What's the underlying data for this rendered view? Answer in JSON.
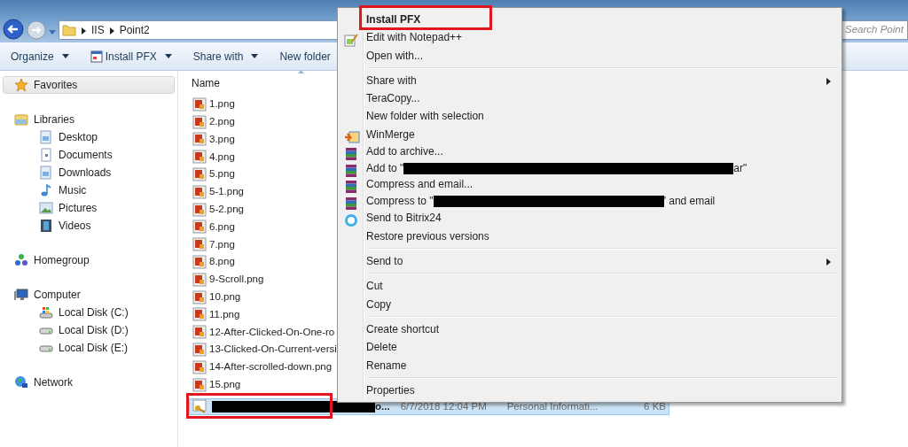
{
  "window": {
    "back": {
      "disabled": false
    },
    "forward": {
      "disabled": true
    },
    "breadcrumbs": [
      "IIS",
      "Point2"
    ],
    "search": {
      "placeholder": "Search Point"
    }
  },
  "toolbar": [
    {
      "label": "Organize",
      "dropdown": true,
      "kind": "plain"
    },
    {
      "label": "Install PFX",
      "dropdown": true,
      "kind": "app"
    },
    {
      "label": "Share with",
      "dropdown": true,
      "kind": "plain"
    },
    {
      "label": "New folder",
      "dropdown": false,
      "kind": "plain"
    }
  ],
  "navigation": [
    {
      "label": "Favorites",
      "kind": "favorites",
      "selected": true
    },
    {
      "label": "Libraries",
      "kind": "library",
      "selected": false,
      "children": [
        {
          "label": "Desktop",
          "kind": "desktop",
          "selected": false
        },
        {
          "label": "Documents",
          "kind": "documents",
          "selected": false
        },
        {
          "label": "Downloads",
          "kind": "desktop",
          "selected": false
        },
        {
          "label": "Music",
          "kind": "music",
          "selected": false
        },
        {
          "label": "Pictures",
          "kind": "pictures",
          "selected": false
        },
        {
          "label": "Videos",
          "kind": "videos",
          "selected": false
        }
      ]
    },
    {
      "label": "Homegroup",
      "kind": "homegroup",
      "selected": false
    },
    {
      "label": "Computer",
      "kind": "computer",
      "selected": false,
      "children": [
        {
          "label": "Local Disk (C:)",
          "kind": "system-disk",
          "selected": false
        },
        {
          "label": "Local Disk (D:)",
          "kind": "disk",
          "selected": false
        },
        {
          "label": "Local Disk (E:)",
          "kind": "disk",
          "selected": false
        }
      ]
    },
    {
      "label": "Network",
      "kind": "network",
      "selected": false
    }
  ],
  "file_list": {
    "columns": [
      {
        "label": "Name",
        "sorted": true
      }
    ],
    "rows": [
      {
        "kind": "image",
        "name": "1.png",
        "selected": false,
        "highlighted": false
      },
      {
        "kind": "image",
        "name": "2.png",
        "selected": false,
        "highlighted": false
      },
      {
        "kind": "image",
        "name": "3.png",
        "selected": false,
        "highlighted": false
      },
      {
        "kind": "image",
        "name": "4.png",
        "selected": false,
        "highlighted": false
      },
      {
        "kind": "image",
        "name": "5.png",
        "selected": false,
        "highlighted": false
      },
      {
        "kind": "image",
        "name": "5-1.png",
        "selected": false,
        "highlighted": false
      },
      {
        "kind": "image",
        "name": "5-2.png",
        "selected": false,
        "highlighted": false
      },
      {
        "kind": "image",
        "name": "6.png",
        "selected": false,
        "highlighted": false
      },
      {
        "kind": "image",
        "name": "7.png",
        "selected": false,
        "highlighted": false
      },
      {
        "kind": "image",
        "name": "8.png",
        "selected": false,
        "highlighted": false
      },
      {
        "kind": "image",
        "name": "9-Scroll.png",
        "selected": false,
        "highlighted": false
      },
      {
        "kind": "image",
        "name": "10.png",
        "selected": false,
        "highlighted": false
      },
      {
        "kind": "image",
        "name": "11.png",
        "selected": false,
        "highlighted": false
      },
      {
        "kind": "image",
        "name": "12-After-Clicked-On-One-ro",
        "selected": false,
        "highlighted": false
      },
      {
        "kind": "image",
        "name": "13-Clicked-On-Current-versi",
        "selected": false,
        "highlighted": false
      },
      {
        "kind": "image",
        "name": "14-After-scrolled-down.png",
        "selected": false,
        "highlighted": false
      },
      {
        "kind": "image",
        "name": "15.png",
        "selected": false,
        "highlighted": false
      },
      {
        "kind": "certificate-redacted",
        "name": "o...",
        "date": "6/7/2018 12:04 PM",
        "type": "Personal Informati...",
        "size": "6 KB",
        "selected": true,
        "highlighted": true
      }
    ]
  },
  "context_menu": [
    {
      "kind": "plain",
      "label": "Install PFX",
      "default": true,
      "submenu": false,
      "highlighted": true
    },
    {
      "kind": "notepad",
      "label": "Edit with Notepad++",
      "default": false,
      "submenu": false,
      "highlighted": false
    },
    {
      "kind": "plain",
      "label": "Open with...",
      "default": false,
      "submenu": false,
      "highlighted": false
    },
    {
      "kind": "separator"
    },
    {
      "kind": "plain",
      "label": "Share with",
      "default": false,
      "submenu": true,
      "highlighted": false
    },
    {
      "kind": "plain",
      "label": "TeraCopy...",
      "default": false,
      "submenu": false,
      "highlighted": false
    },
    {
      "kind": "plain",
      "label": "New folder with selection",
      "default": false,
      "submenu": false,
      "highlighted": false
    },
    {
      "kind": "merge",
      "label": "WinMerge",
      "default": false,
      "submenu": false,
      "highlighted": false
    },
    {
      "kind": "archive",
      "label": "Add to archive...",
      "default": false,
      "submenu": false,
      "highlighted": false
    },
    {
      "kind": "archive-redacted",
      "label": "Add to \"",
      "after": "ar\"",
      "default": false,
      "submenu": false,
      "highlighted": false
    },
    {
      "kind": "archive",
      "label": "Compress and email...",
      "default": false,
      "submenu": false,
      "highlighted": false
    },
    {
      "kind": "archive-redacted",
      "label": "Compress to \"",
      "after": "' and email",
      "default": false,
      "submenu": false,
      "highlighted": false
    },
    {
      "kind": "chat",
      "label": "Send to Bitrix24",
      "default": false,
      "submenu": false,
      "highlighted": false
    },
    {
      "kind": "plain",
      "label": "Restore previous versions",
      "default": false,
      "submenu": false,
      "highlighted": false
    },
    {
      "kind": "separator"
    },
    {
      "kind": "plain",
      "label": "Send to",
      "default": false,
      "submenu": true,
      "highlighted": false
    },
    {
      "kind": "separator"
    },
    {
      "kind": "plain",
      "label": "Cut",
      "default": false,
      "submenu": false,
      "highlighted": false
    },
    {
      "kind": "plain",
      "label": "Copy",
      "default": false,
      "submenu": false,
      "highlighted": false
    },
    {
      "kind": "separator"
    },
    {
      "kind": "plain",
      "label": "Create shortcut",
      "default": false,
      "submenu": false,
      "highlighted": false
    },
    {
      "kind": "plain",
      "label": "Delete",
      "default": false,
      "submenu": false,
      "highlighted": false
    },
    {
      "kind": "plain",
      "label": "Rename",
      "default": false,
      "submenu": false,
      "highlighted": false
    },
    {
      "kind": "separator"
    },
    {
      "kind": "plain",
      "label": "Properties",
      "default": false,
      "submenu": false,
      "highlighted": false
    }
  ]
}
